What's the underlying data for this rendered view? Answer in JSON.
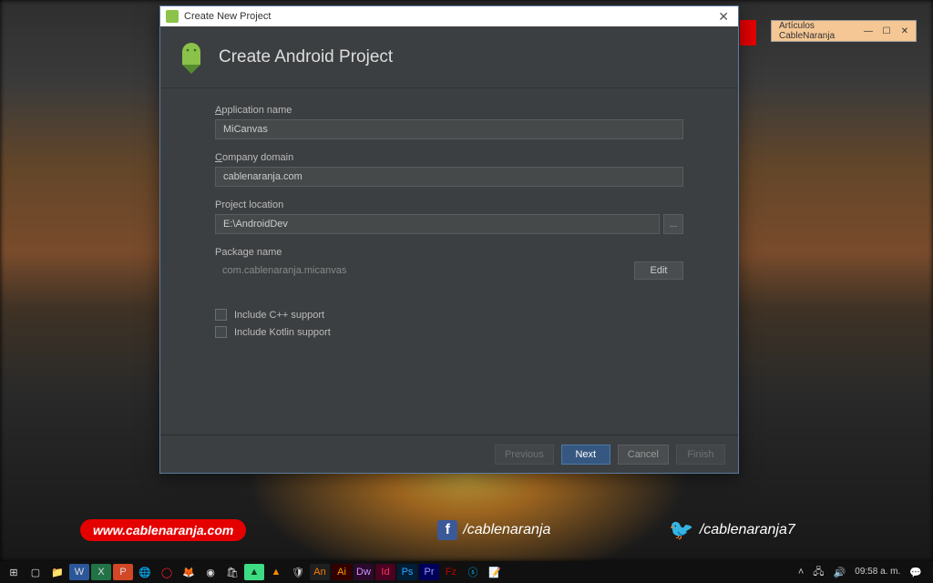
{
  "desktop": {
    "promo_url": "www.cablenaranja.com",
    "facebook_handle": "/cablenaranja",
    "twitter_handle": "/cablenaranja7"
  },
  "mini_window": {
    "title": "Artículos CableNaranja"
  },
  "dialog": {
    "window_title": "Create New Project",
    "header_title": "Create Android Project",
    "fields": {
      "app_name_label_pre": "A",
      "app_name_label_rest": "pplication name",
      "app_name_value": "MiCanvas",
      "company_label_pre": "C",
      "company_label_rest": "ompany domain",
      "company_value": "cablenaranja.com",
      "location_label": "Project location",
      "location_value": "E:\\AndroidDev",
      "browse_label": "...",
      "package_label": "Package name",
      "package_value": "com.cablenaranja.micanvas",
      "edit_label": "Edit",
      "cpp_label": "Include C++ support",
      "kotlin_label": "Include Kotlin support"
    },
    "buttons": {
      "previous": "Previous",
      "next": "Next",
      "cancel": "Cancel",
      "finish": "Finish"
    }
  },
  "taskbar": {
    "time": "09:58 a. m."
  }
}
